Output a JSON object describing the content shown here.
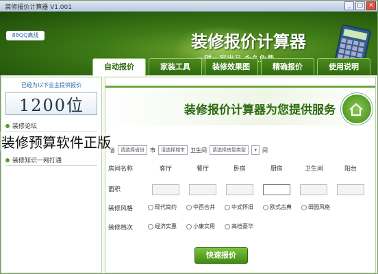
{
  "window": {
    "title": "装修报价计算器 V1.001",
    "controls": [
      "×",
      "□",
      "_"
    ]
  },
  "banner": {
    "brand": "88QQ离线",
    "title": "装修报价计算器",
    "slogan": "一键一家出品 永久免费"
  },
  "tabs": [
    {
      "label": "自动报价",
      "active": true
    },
    {
      "label": "家装工具",
      "active": false
    },
    {
      "label": "装修效果图",
      "active": false
    },
    {
      "label": "精确报价",
      "active": false
    },
    {
      "label": "使用说明",
      "active": false
    }
  ],
  "left_panel": {
    "note": "已经为以下业主提供报价",
    "counter": "1200位",
    "sections": [
      "装修论坛",
      "装修知识一网打通"
    ]
  },
  "hero": {
    "headline": "装修报价计算器为您提供服务"
  },
  "filters": {
    "province_label": "省",
    "province": "请选择省份",
    "city_label": "市",
    "city": "请选择城市",
    "bathroom_label": "卫生间",
    "bathroom": "请选择房型类型",
    "count_label": "间"
  },
  "room_row": {
    "label": "房间名称",
    "cells": [
      "客厅",
      "餐厅",
      "卧房",
      "厨房",
      "卫生间",
      "阳台"
    ]
  },
  "area_row": {
    "label": "面积"
  },
  "style_row": {
    "label": "装修风格",
    "options": [
      "现代简约",
      "中西合并",
      "中式怀旧",
      "欧式古典",
      "田园风格"
    ]
  },
  "grade_row": {
    "label": "装修档次",
    "options": [
      "经济实惠",
      "小康实用",
      "高档豪华"
    ]
  },
  "submit_label": "快速报价",
  "overlay_caption": "装修预算软件正版"
}
